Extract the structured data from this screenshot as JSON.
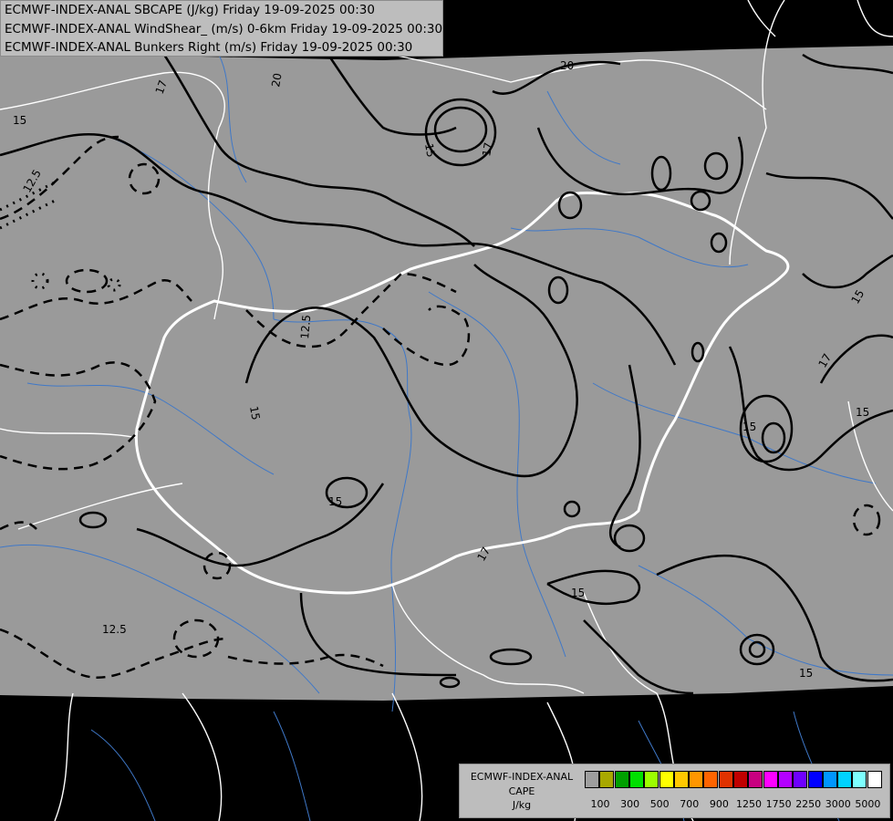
{
  "header": {
    "lines": [
      "ECMWF-INDEX-ANAL SBCAPE (J/kg) Friday 19-09-2025 00:30",
      "ECMWF-INDEX-ANAL WindShear_ (m/s) 0-6km Friday 19-09-2025 00:30",
      "ECMWF-INDEX-ANAL Bunkers Right (m/s) Friday 19-09-2025 00:30"
    ]
  },
  "legend": {
    "name_lines": [
      "ECMWF-INDEX-ANAL",
      "CAPE",
      "J/kg"
    ],
    "colors": [
      "#9e9e9e",
      "#a8a800",
      "#00a000",
      "#00e000",
      "#9cff00",
      "#ffff00",
      "#ffc800",
      "#ff9600",
      "#ff6400",
      "#e03200",
      "#c00000",
      "#c80080",
      "#ff00ff",
      "#b400ff",
      "#6e00ff",
      "#0000ff",
      "#0096ff",
      "#00d2ff",
      "#7dffff",
      "#ffffff"
    ],
    "tick_labels": [
      "100",
      "300",
      "500",
      "700",
      "900",
      "1250",
      "1750",
      "2250",
      "3000",
      "5000"
    ]
  },
  "contour_labels": [
    "20",
    "17",
    "20",
    "15",
    "15",
    "17",
    "12.5",
    "12.5",
    "15",
    "15",
    "17",
    "15",
    "15",
    "17",
    "15",
    "15",
    "12.5",
    "15"
  ]
}
